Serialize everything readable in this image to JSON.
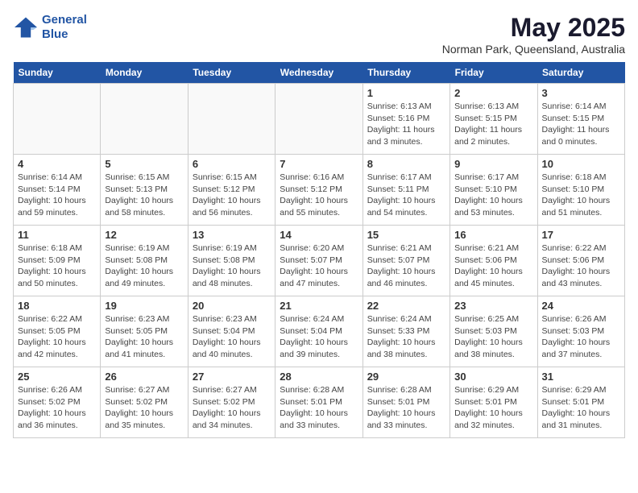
{
  "header": {
    "logo_line1": "General",
    "logo_line2": "Blue",
    "month": "May 2025",
    "location": "Norman Park, Queensland, Australia"
  },
  "weekdays": [
    "Sunday",
    "Monday",
    "Tuesday",
    "Wednesday",
    "Thursday",
    "Friday",
    "Saturday"
  ],
  "weeks": [
    [
      {
        "day": "",
        "info": ""
      },
      {
        "day": "",
        "info": ""
      },
      {
        "day": "",
        "info": ""
      },
      {
        "day": "",
        "info": ""
      },
      {
        "day": "1",
        "info": "Sunrise: 6:13 AM\nSunset: 5:16 PM\nDaylight: 11 hours\nand 3 minutes."
      },
      {
        "day": "2",
        "info": "Sunrise: 6:13 AM\nSunset: 5:15 PM\nDaylight: 11 hours\nand 2 minutes."
      },
      {
        "day": "3",
        "info": "Sunrise: 6:14 AM\nSunset: 5:15 PM\nDaylight: 11 hours\nand 0 minutes."
      }
    ],
    [
      {
        "day": "4",
        "info": "Sunrise: 6:14 AM\nSunset: 5:14 PM\nDaylight: 10 hours\nand 59 minutes."
      },
      {
        "day": "5",
        "info": "Sunrise: 6:15 AM\nSunset: 5:13 PM\nDaylight: 10 hours\nand 58 minutes."
      },
      {
        "day": "6",
        "info": "Sunrise: 6:15 AM\nSunset: 5:12 PM\nDaylight: 10 hours\nand 56 minutes."
      },
      {
        "day": "7",
        "info": "Sunrise: 6:16 AM\nSunset: 5:12 PM\nDaylight: 10 hours\nand 55 minutes."
      },
      {
        "day": "8",
        "info": "Sunrise: 6:17 AM\nSunset: 5:11 PM\nDaylight: 10 hours\nand 54 minutes."
      },
      {
        "day": "9",
        "info": "Sunrise: 6:17 AM\nSunset: 5:10 PM\nDaylight: 10 hours\nand 53 minutes."
      },
      {
        "day": "10",
        "info": "Sunrise: 6:18 AM\nSunset: 5:10 PM\nDaylight: 10 hours\nand 51 minutes."
      }
    ],
    [
      {
        "day": "11",
        "info": "Sunrise: 6:18 AM\nSunset: 5:09 PM\nDaylight: 10 hours\nand 50 minutes."
      },
      {
        "day": "12",
        "info": "Sunrise: 6:19 AM\nSunset: 5:08 PM\nDaylight: 10 hours\nand 49 minutes."
      },
      {
        "day": "13",
        "info": "Sunrise: 6:19 AM\nSunset: 5:08 PM\nDaylight: 10 hours\nand 48 minutes."
      },
      {
        "day": "14",
        "info": "Sunrise: 6:20 AM\nSunset: 5:07 PM\nDaylight: 10 hours\nand 47 minutes."
      },
      {
        "day": "15",
        "info": "Sunrise: 6:21 AM\nSunset: 5:07 PM\nDaylight: 10 hours\nand 46 minutes."
      },
      {
        "day": "16",
        "info": "Sunrise: 6:21 AM\nSunset: 5:06 PM\nDaylight: 10 hours\nand 45 minutes."
      },
      {
        "day": "17",
        "info": "Sunrise: 6:22 AM\nSunset: 5:06 PM\nDaylight: 10 hours\nand 43 minutes."
      }
    ],
    [
      {
        "day": "18",
        "info": "Sunrise: 6:22 AM\nSunset: 5:05 PM\nDaylight: 10 hours\nand 42 minutes."
      },
      {
        "day": "19",
        "info": "Sunrise: 6:23 AM\nSunset: 5:05 PM\nDaylight: 10 hours\nand 41 minutes."
      },
      {
        "day": "20",
        "info": "Sunrise: 6:23 AM\nSunset: 5:04 PM\nDaylight: 10 hours\nand 40 minutes."
      },
      {
        "day": "21",
        "info": "Sunrise: 6:24 AM\nSunset: 5:04 PM\nDaylight: 10 hours\nand 39 minutes."
      },
      {
        "day": "22",
        "info": "Sunrise: 6:24 AM\nSunset: 5:33 PM\nDaylight: 10 hours\nand 38 minutes."
      },
      {
        "day": "23",
        "info": "Sunrise: 6:25 AM\nSunset: 5:03 PM\nDaylight: 10 hours\nand 38 minutes."
      },
      {
        "day": "24",
        "info": "Sunrise: 6:26 AM\nSunset: 5:03 PM\nDaylight: 10 hours\nand 37 minutes."
      }
    ],
    [
      {
        "day": "25",
        "info": "Sunrise: 6:26 AM\nSunset: 5:02 PM\nDaylight: 10 hours\nand 36 minutes."
      },
      {
        "day": "26",
        "info": "Sunrise: 6:27 AM\nSunset: 5:02 PM\nDaylight: 10 hours\nand 35 minutes."
      },
      {
        "day": "27",
        "info": "Sunrise: 6:27 AM\nSunset: 5:02 PM\nDaylight: 10 hours\nand 34 minutes."
      },
      {
        "day": "28",
        "info": "Sunrise: 6:28 AM\nSunset: 5:01 PM\nDaylight: 10 hours\nand 33 minutes."
      },
      {
        "day": "29",
        "info": "Sunrise: 6:28 AM\nSunset: 5:01 PM\nDaylight: 10 hours\nand 33 minutes."
      },
      {
        "day": "30",
        "info": "Sunrise: 6:29 AM\nSunset: 5:01 PM\nDaylight: 10 hours\nand 32 minutes."
      },
      {
        "day": "31",
        "info": "Sunrise: 6:29 AM\nSunset: 5:01 PM\nDaylight: 10 hours\nand 31 minutes."
      }
    ]
  ]
}
